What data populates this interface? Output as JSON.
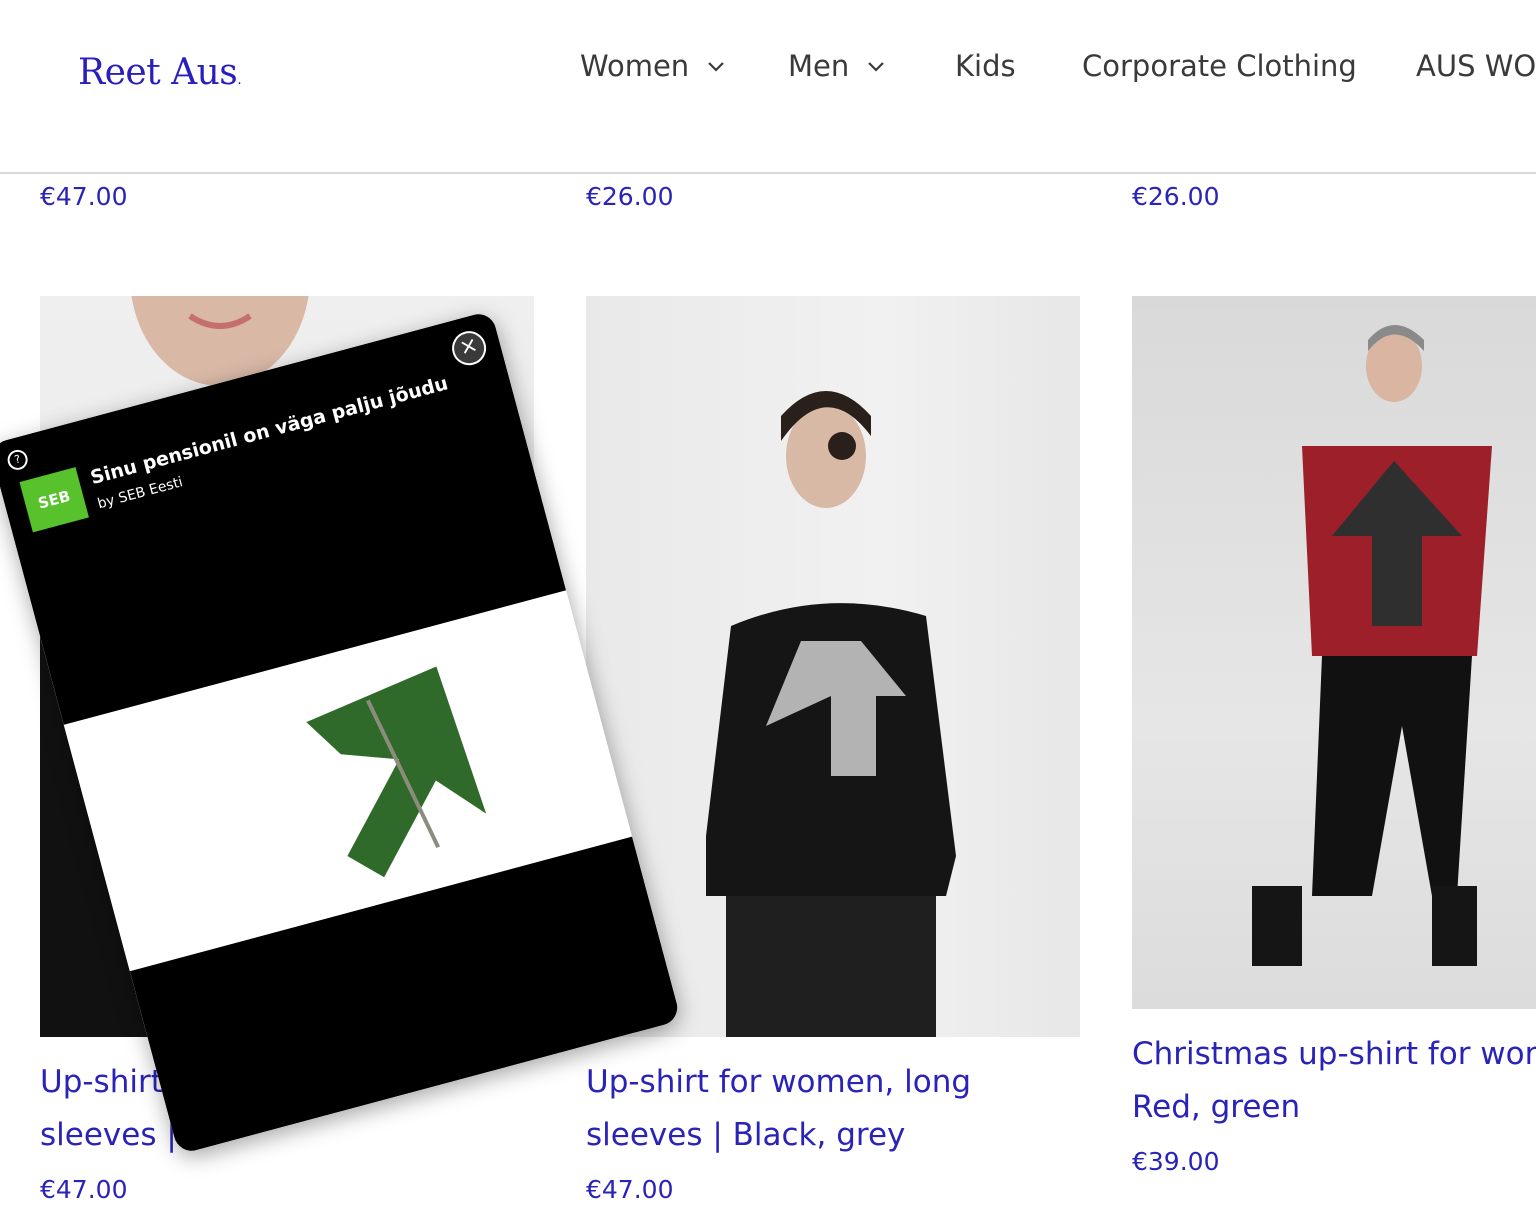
{
  "header": {
    "logo_text": "Reet Aus",
    "nav": [
      {
        "label": "Women",
        "has_dropdown": true
      },
      {
        "label": "Men",
        "has_dropdown": true
      },
      {
        "label": "Kids",
        "has_dropdown": false
      },
      {
        "label": "Corporate Clothing",
        "has_dropdown": false
      },
      {
        "label": "AUS WO",
        "has_dropdown": false
      }
    ]
  },
  "top_row_prices": [
    "€47.00",
    "€26.00",
    "€26.00"
  ],
  "products": [
    {
      "title_line1": "Up-shirt f",
      "title_line2": "sleeves | B",
      "price": "€47.00"
    },
    {
      "title_line1": "Up-shirt for women, long",
      "title_line2": "sleeves | Black, grey",
      "price": "€47.00"
    },
    {
      "title_line1": "Christmas up-shirt for wor",
      "title_line2": "Red, green",
      "price": "€39.00"
    }
  ],
  "ad": {
    "title": "Sinu pensionil on väga palju jõudu",
    "by": "by SEB Eesti",
    "logo_text": "SEB",
    "help_icon": "?",
    "close_icon": "×"
  }
}
